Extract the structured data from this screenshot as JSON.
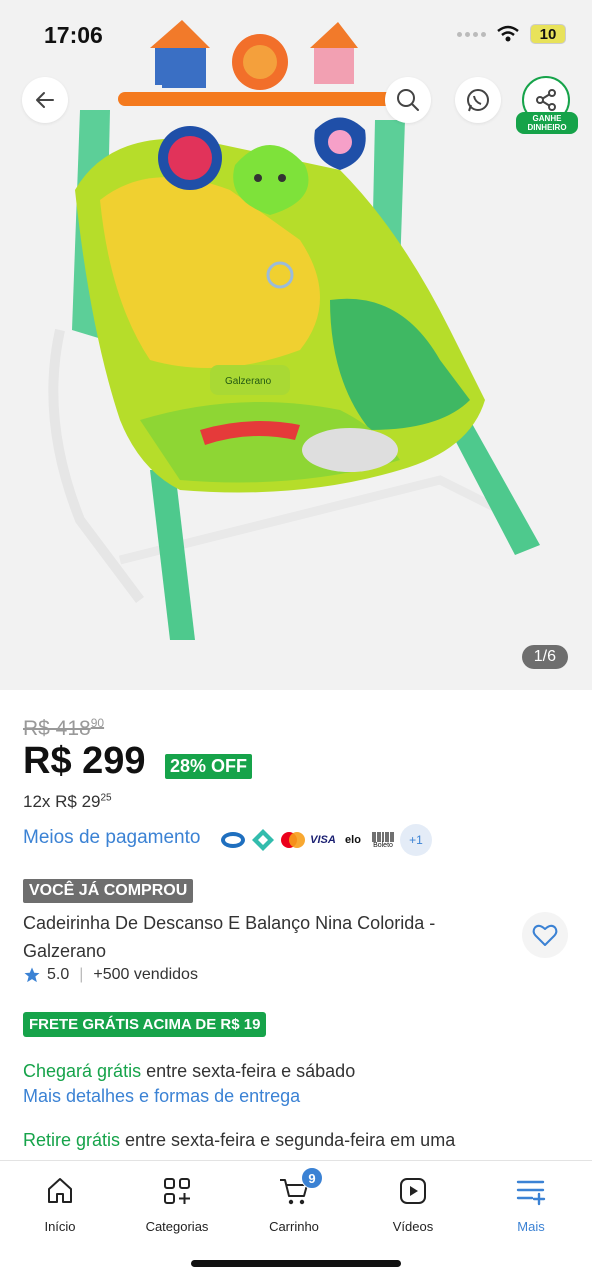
{
  "status_bar": {
    "time": "17:06",
    "battery": "10"
  },
  "gallery": {
    "counter": "1/6",
    "share_label": "GANHE DINHEIRO",
    "product_image": {
      "brand_on_product": "Galzerano"
    }
  },
  "product": {
    "old_price": "R$ 418",
    "old_price_cents": "90",
    "price": "R$ 299",
    "discount": "28% OFF",
    "installments": "12x R$ 29",
    "installments_cents": "25",
    "payment_link": "Meios de pagamento",
    "payment_methods": [
      "boleto-bank",
      "pix",
      "mastercard",
      "VISA",
      "elo",
      "Boleto"
    ],
    "payment_more": "+1",
    "bought_badge": "VOCÊ JÁ COMPROU",
    "title": "Cadeirinha De Descanso E Balanço Nina Colorida - Galzerano",
    "rating": "5.0",
    "sold": "+500 vendidos",
    "free_shipping_badge": "FRETE GRÁTIS ACIMA DE R$ 19",
    "delivery_highlight": "Chegará grátis",
    "delivery_text": " entre sexta-feira e sábado",
    "delivery_link": "Mais detalhes e formas de entrega",
    "pickup_highlight": "Retire grátis",
    "pickup_text": " entre sexta-feira e segunda-feira em uma"
  },
  "tabbar": {
    "cart_count": "9",
    "tabs": [
      {
        "label": "Início",
        "icon": "home-icon"
      },
      {
        "label": "Categorias",
        "icon": "categories-icon"
      },
      {
        "label": "Carrinho",
        "icon": "cart-icon"
      },
      {
        "label": "Vídeos",
        "icon": "video-icon"
      },
      {
        "label": "Mais",
        "icon": "menu-plus-icon"
      }
    ]
  },
  "colors": {
    "accent_blue": "#3b82d4",
    "green": "#16a34a",
    "gray_badge": "#6e6e6e"
  }
}
